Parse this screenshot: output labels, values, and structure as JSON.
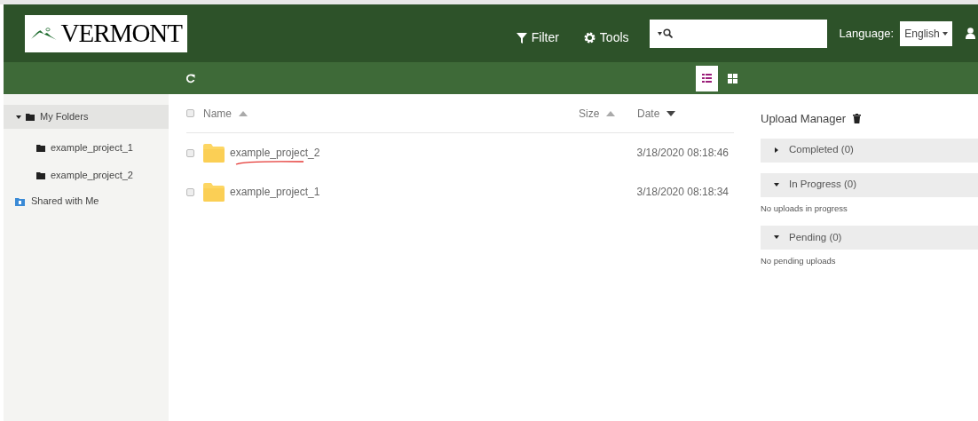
{
  "header": {
    "logo_text": "VERMONT",
    "filter": "Filter",
    "tools": "Tools",
    "language_label": "Language:",
    "language": "English"
  },
  "toolbar": {
    "views": [
      {
        "kind": "list",
        "selected": true
      },
      {
        "kind": "grid",
        "selected": false
      }
    ]
  },
  "sidebar": {
    "items": [
      {
        "label": "My Folders",
        "kind": "folder",
        "expanded": true,
        "selected": true,
        "children": [
          {
            "label": "example_project_1",
            "kind": "folder",
            "selected": false
          },
          {
            "label": "example_project_2",
            "kind": "folder",
            "selected": false
          }
        ]
      },
      {
        "label": "Shared with Me",
        "kind": "shared",
        "selected": false
      }
    ]
  },
  "table": {
    "all_checked": false,
    "columns": [
      {
        "label": "Name",
        "ascending": true
      },
      {
        "label": "Size",
        "ascending": true
      },
      {
        "label": "Date",
        "ascending": false
      }
    ],
    "rows": [
      {
        "name": "example_project_2",
        "date": "3/18/2020 08:18:46",
        "checked": false,
        "underlined": true
      },
      {
        "name": "example_project_1",
        "date": "3/18/2020 08:18:34",
        "checked": false,
        "underlined": false
      }
    ]
  },
  "upload_manager": {
    "title": "Upload Manager",
    "sections": [
      {
        "label": "Completed (0)",
        "expanded": false
      },
      {
        "label": "In Progress (0)",
        "expanded": true,
        "message": "No uploads in progress"
      },
      {
        "label": "Pending (0)",
        "expanded": true,
        "message": "No pending uploads"
      }
    ]
  }
}
